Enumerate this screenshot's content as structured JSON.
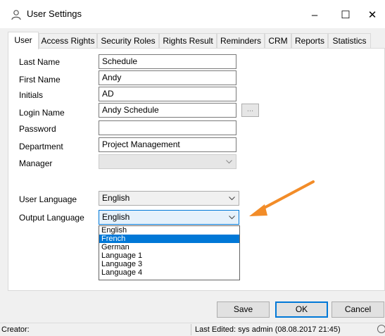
{
  "window": {
    "title": "User Settings",
    "icon": "user-icon",
    "controls": {
      "minimize": "–",
      "maximize": "☐",
      "close": "✕"
    }
  },
  "tabs": [
    {
      "label": "User",
      "active": true
    },
    {
      "label": "Access Rights"
    },
    {
      "label": "Security Roles"
    },
    {
      "label": "Rights Result"
    },
    {
      "label": "Reminders"
    },
    {
      "label": "CRM"
    },
    {
      "label": "Reports"
    },
    {
      "label": "Statistics"
    }
  ],
  "form": {
    "last_name": {
      "label": "Last Name",
      "value": "Schedule"
    },
    "first_name": {
      "label": "First Name",
      "value": "Andy"
    },
    "initials": {
      "label": "Initials",
      "value": "AD"
    },
    "login_name": {
      "label": "Login Name",
      "value": "Andy Schedule",
      "browse": "..."
    },
    "password": {
      "label": "Password",
      "value": ""
    },
    "department": {
      "label": "Department",
      "value": "Project Management"
    },
    "manager": {
      "label": "Manager",
      "value": ""
    },
    "user_language": {
      "label": "User Language",
      "value": "English"
    },
    "output_language": {
      "label": "Output Language",
      "value": "English",
      "options": [
        "English",
        "French",
        "German",
        "Language 1",
        "Language 3",
        "Language 4"
      ],
      "highlighted": "French"
    }
  },
  "buttons": {
    "save": "Save",
    "ok": "OK",
    "cancel": "Cancel"
  },
  "status": {
    "creator": "Creator:",
    "last_edited": "Last Edited:  sys admin (08.08.2017 21:45)"
  },
  "colors": {
    "accent": "#0078d7",
    "arrow": "#f28c28"
  }
}
